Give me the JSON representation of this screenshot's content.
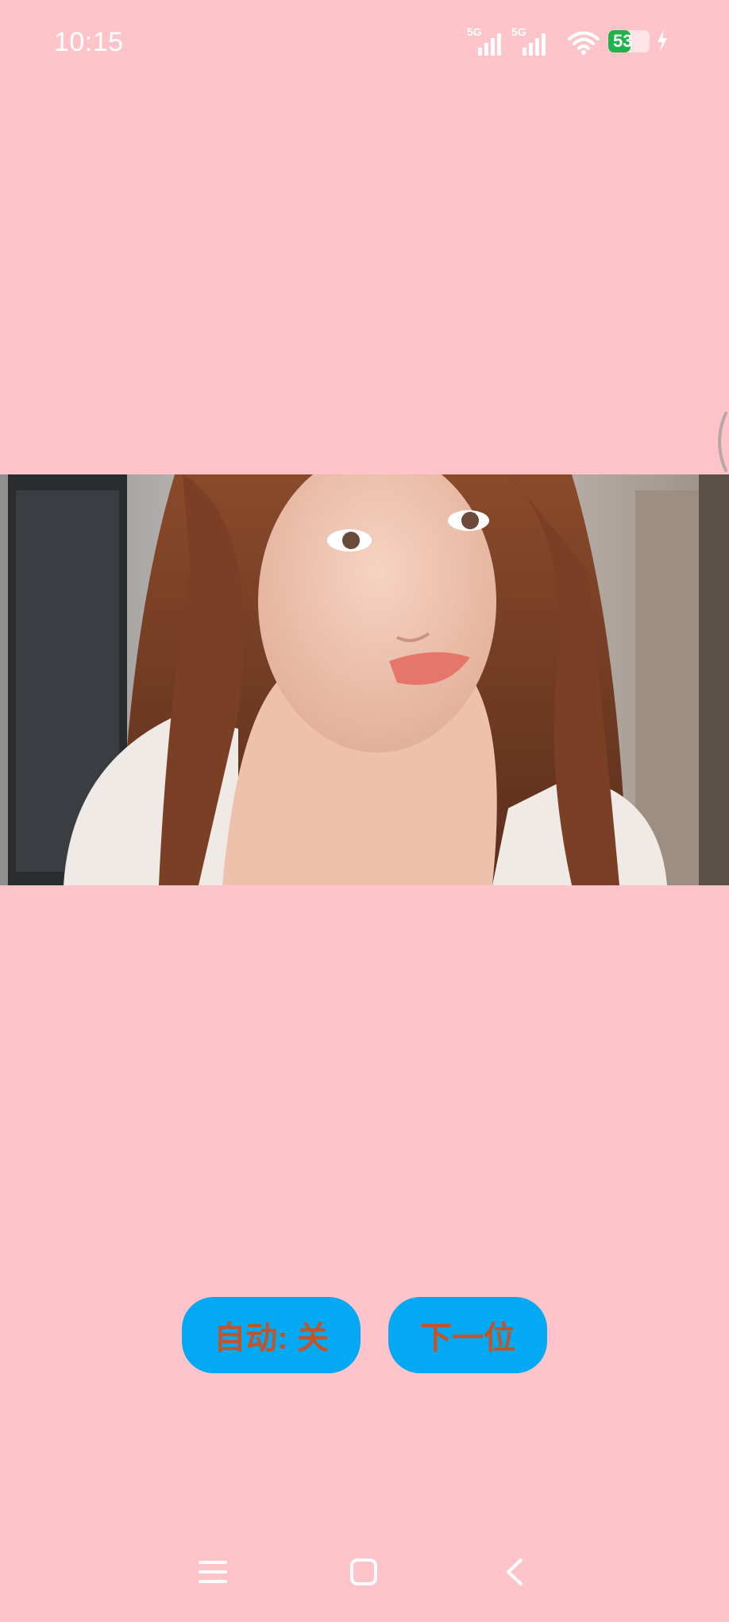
{
  "status_bar": {
    "time": "10:15",
    "signal_1_label": "5G",
    "signal_2_label": "5G",
    "battery_level": "53",
    "battery_fraction": 0.53,
    "icons": [
      "signal-5g-icon",
      "signal-5g-icon",
      "wifi-icon",
      "battery-icon",
      "charging-icon"
    ]
  },
  "video": {
    "description_icon": "video-frame"
  },
  "controls": {
    "auto_button_label": "自动: 关",
    "next_button_label": "下一位"
  },
  "nav_bar": {
    "icons": [
      "menu-icon",
      "home-icon",
      "back-icon"
    ]
  },
  "colors": {
    "background": "#ffc4c9",
    "button_background": "#04a9f4",
    "button_text": "#c25428"
  }
}
